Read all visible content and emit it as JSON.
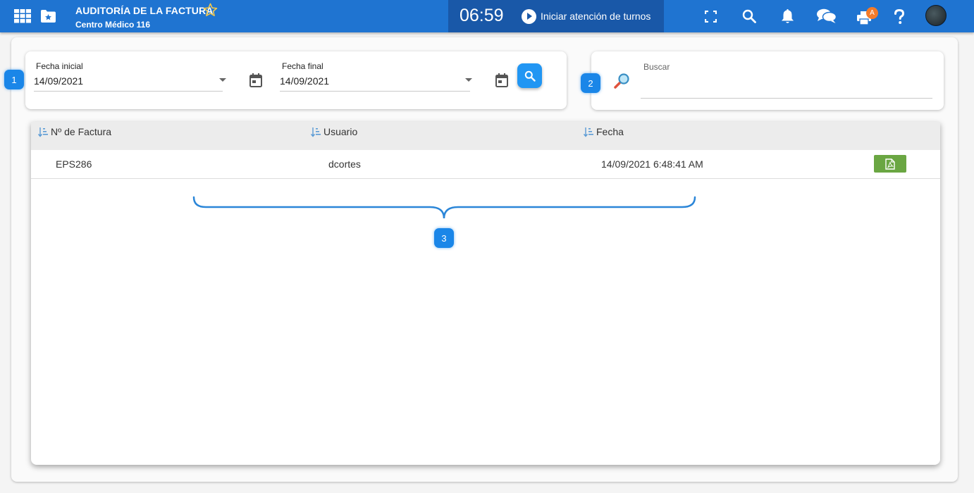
{
  "header": {
    "title": "AUDITORÍA DE LA FACTURA",
    "subtitle": "Centro Médico 116",
    "clock": "06:59",
    "turns_label": "Iniciar atención de turnos",
    "badge": "A",
    "icons": [
      "apps-grid-icon",
      "star-folder-icon",
      "star-icon",
      "fullscreen-icon",
      "search-icon",
      "bell-icon",
      "chat-icon",
      "printer-icon",
      "help-icon",
      "avatar"
    ]
  },
  "filters": {
    "start_label": "Fecha inicial",
    "start_value": "14/09/2021",
    "end_label": "Fecha final",
    "end_value": "14/09/2021"
  },
  "search": {
    "label": "Buscar",
    "value": ""
  },
  "steps": [
    "1",
    "2",
    "3"
  ],
  "table": {
    "columns": [
      "Nº de Factura",
      "Usuario",
      "Fecha"
    ],
    "rows": [
      {
        "invoice": "EPS286",
        "user": "dcortes",
        "date": "14/09/2021 6:48:41 AM"
      }
    ]
  },
  "colors": {
    "topbar": "#1f74d1",
    "turns_bg": "#1958a8",
    "accent": "#2196f3",
    "step_badge": "#1a86e8",
    "pdf_button": "#6aa642",
    "notification_badge": "#f47b29"
  }
}
